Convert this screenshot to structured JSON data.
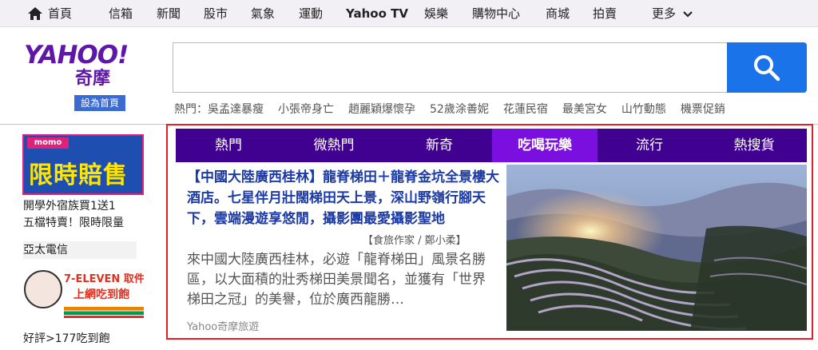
{
  "topnav": {
    "home": "首頁",
    "items": [
      "信箱",
      "新聞",
      "股市",
      "氣象",
      "運動",
      "Yahoo TV",
      "娛樂",
      "購物中心",
      "商城",
      "拍賣"
    ],
    "more": "更多"
  },
  "logo": {
    "wordmark": "YAHOO!",
    "subtitle": "奇摩"
  },
  "homepage_button": "設為首頁",
  "search": {
    "value": "",
    "placeholder": ""
  },
  "trending": {
    "label": "熱門：",
    "items": [
      "吳孟達暴瘦",
      "小張帝身亡",
      "趙麗穎爆懷孕",
      "52歲涂善妮",
      "花蓮民宿",
      "最美宮女",
      "山竹動態",
      "機票促銷"
    ]
  },
  "ads": {
    "momo": {
      "brand": "momo",
      "headline": "限時賠售",
      "caption_1": "開學外宿族買1送1",
      "caption_2": "五檔特賣！限時限量"
    },
    "sponsor": "亞太電信",
    "seven": {
      "line1": "7-ELEVEN 取件",
      "line2": "上網吃到飽",
      "caption": "好評>177吃到飽"
    }
  },
  "module": {
    "tabs": [
      "熱門",
      "微熱門",
      "新奇",
      "吃喝玩樂",
      "流行",
      "熱搜貨"
    ],
    "active_tab": 3,
    "story": {
      "title": "【中國大陸廣西桂林】龍脊梯田＋龍脊金坑全景樓大酒店。七星伴月壯闊梯田天上景，深山野嶺行腳天下，雲端漫遊享悠閒，攝影團最愛攝影聖地",
      "author": "【食旅作家 / 鄭小柔】",
      "summary": "來中國大陸廣西桂林，必遊「龍脊梯田」風景名勝區，以大面積的壯秀梯田美景聞名，並獲有「世界梯田之冠」的美譽，位於廣西龍勝…",
      "source": "Yahoo奇摩旅遊"
    }
  },
  "colors": {
    "brand_purple": "#400090",
    "active_tab": "#7b0fe0",
    "search_blue": "#1a73e8",
    "highlight_border": "#e0202a"
  }
}
